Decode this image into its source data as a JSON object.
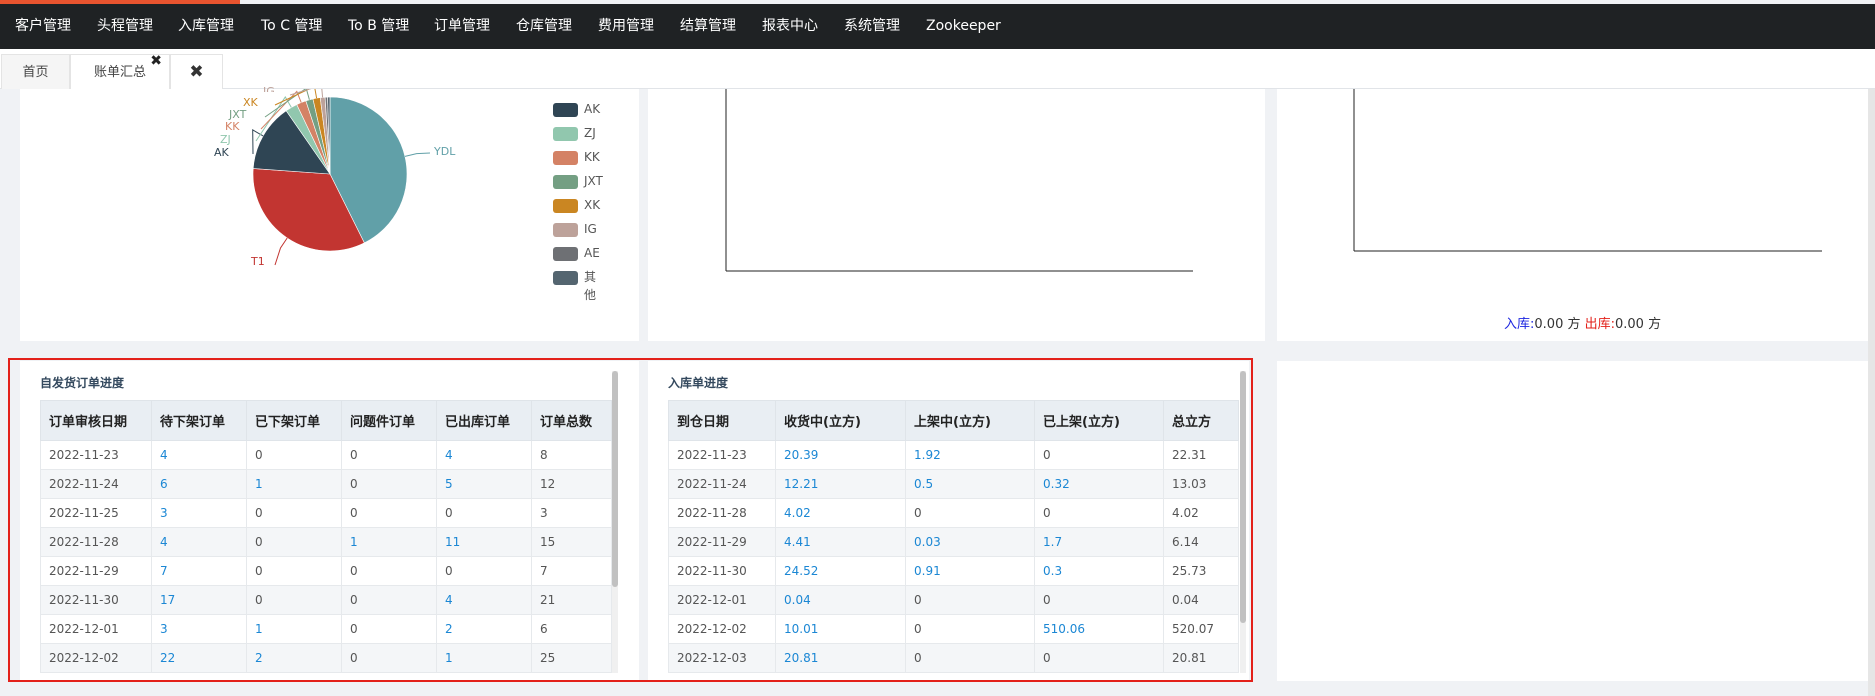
{
  "nav": [
    "客户管理",
    "头程管理",
    "入库管理",
    "To C 管理",
    "To B 管理",
    "订单管理",
    "仓库管理",
    "费用管理",
    "结算管理",
    "报表中心",
    "系统管理",
    "Zookeeper"
  ],
  "tabs": [
    "首页",
    "账单汇总"
  ],
  "pie_labels": [
    "YDL",
    "T1",
    "AK",
    "ZJ",
    "KK",
    "JXT",
    "XK",
    "IG"
  ],
  "legend": [
    "AK",
    "ZJ",
    "KK",
    "JXT",
    "XK",
    "IG",
    "AE",
    "其他"
  ],
  "summary": {
    "in_label": "入库:",
    "in_value": "0.00 方",
    "out_label": "出库:",
    "out_value": "0.00 方"
  },
  "chart_data": {
    "type": "pie",
    "categories": [
      "YDL",
      "T1",
      "AK",
      "ZJ",
      "KK",
      "JXT",
      "XK",
      "IG",
      "AE",
      "其他"
    ],
    "values": [
      42,
      33,
      14,
      2.5,
      2,
      1.5,
      1.5,
      1,
      0.5,
      0.5
    ],
    "colors": [
      "#61a0a8",
      "#c23531",
      "#2f4554",
      "#91c7ae",
      "#d48265",
      "#749f83",
      "#ca8622",
      "#bda29a",
      "#6e7074",
      "#546570"
    ],
    "legend": "right"
  },
  "table1": {
    "title": "自发货订单进度",
    "headers": [
      "订单审核日期",
      "待下架订单",
      "已下架订单",
      "问题件订单",
      "已出库订单",
      "订单总数"
    ],
    "rows": [
      [
        "2022-11-23",
        "4",
        "0",
        "0",
        "4",
        "8"
      ],
      [
        "2022-11-24",
        "6",
        "1",
        "0",
        "5",
        "12"
      ],
      [
        "2022-11-25",
        "3",
        "0",
        "0",
        "0",
        "3"
      ],
      [
        "2022-11-28",
        "4",
        "0",
        "1",
        "11",
        "15"
      ],
      [
        "2022-11-29",
        "7",
        "0",
        "0",
        "0",
        "7"
      ],
      [
        "2022-11-30",
        "17",
        "0",
        "0",
        "4",
        "21"
      ],
      [
        "2022-12-01",
        "3",
        "1",
        "0",
        "2",
        "6"
      ],
      [
        "2022-12-02",
        "22",
        "2",
        "0",
        "1",
        "25"
      ]
    ]
  },
  "table2": {
    "title": "入库单进度",
    "headers": [
      "到仓日期",
      "收货中(立方)",
      "上架中(立方)",
      "已上架(立方)",
      "总立方"
    ],
    "rows": [
      [
        "2022-11-23",
        "20.39",
        "1.92",
        "0",
        "22.31"
      ],
      [
        "2022-11-24",
        "12.21",
        "0.5",
        "0.32",
        "13.03"
      ],
      [
        "2022-11-28",
        "4.02",
        "0",
        "0",
        "4.02"
      ],
      [
        "2022-11-29",
        "4.41",
        "0.03",
        "1.7",
        "6.14"
      ],
      [
        "2022-11-30",
        "24.52",
        "0.91",
        "0.3",
        "25.73"
      ],
      [
        "2022-12-01",
        "0.04",
        "0",
        "0",
        "0.04"
      ],
      [
        "2022-12-02",
        "10.01",
        "0",
        "510.06",
        "520.07"
      ],
      [
        "2022-12-03",
        "20.81",
        "0",
        "0",
        "20.81"
      ]
    ]
  }
}
